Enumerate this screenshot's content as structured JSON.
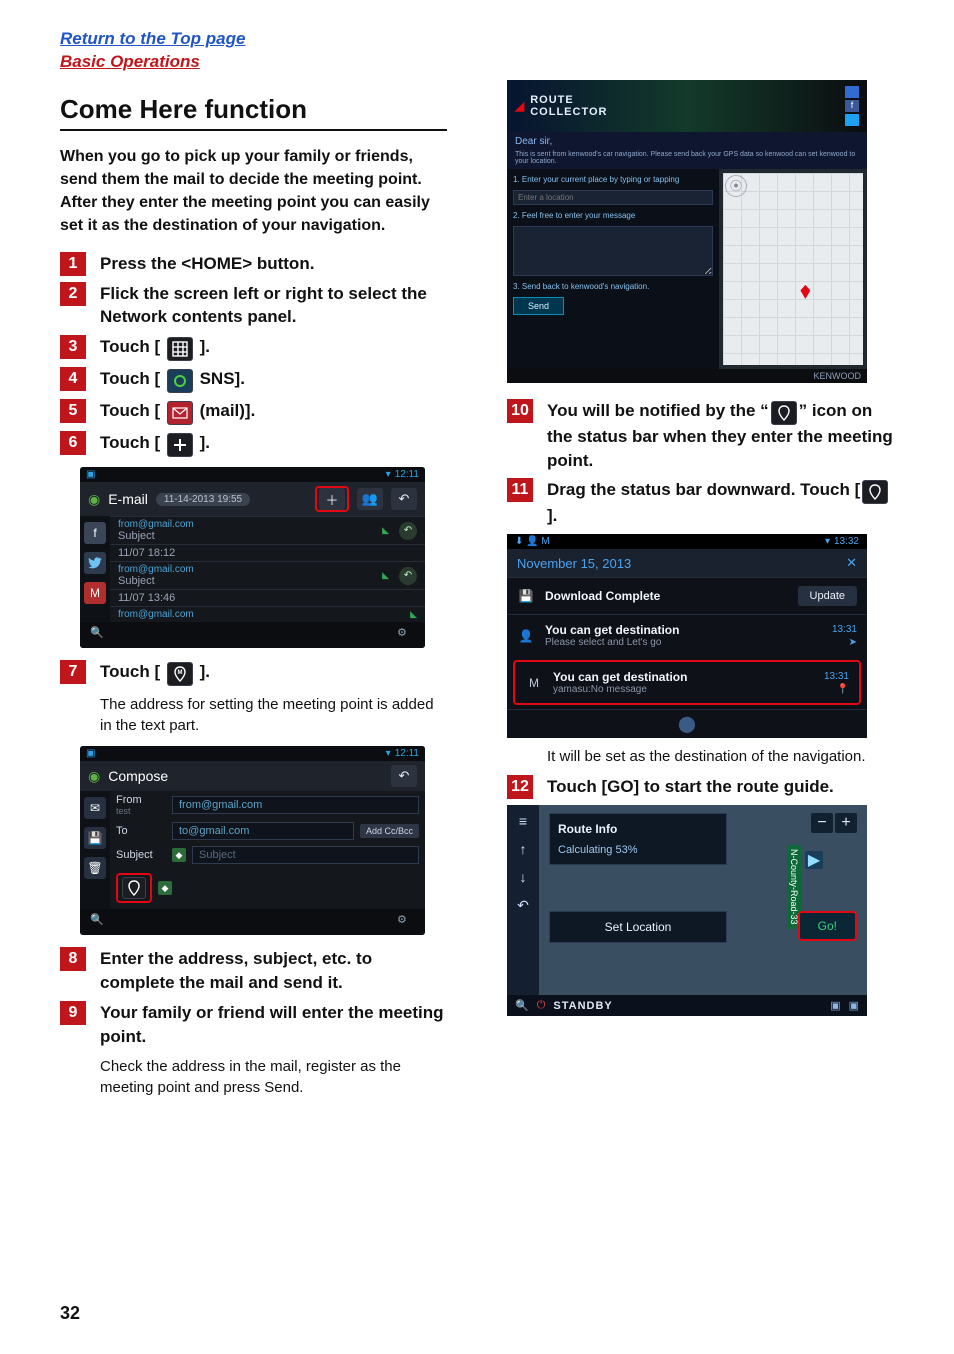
{
  "top_links": {
    "return": "Return to the Top page",
    "basic": "Basic Operations"
  },
  "title": "Come Here function",
  "intro": "When you go to pick up your family or friends, send them the mail to decide the meeting point. After they enter the meeting point you can easily set it as the destination of your navigation.",
  "steps": {
    "s1": "Press the <HOME> button.",
    "s2": "Flick the screen left or right to select the Network contents panel.",
    "s3a": "Touch [",
    "s3b": "].",
    "s4a": "Touch [",
    "s4b": "SNS].",
    "s5a": "Touch [",
    "s5b": "(mail)].",
    "s6a": "Touch [",
    "s6b": "].",
    "s7a": "Touch [",
    "s7b": "].",
    "s7_note": "The address for setting the meeting point is added in the text part.",
    "s8": "Enter the address, subject, etc. to complete the mail and send it.",
    "s9": "Your family or friend will enter the meeting point.",
    "s9_note": "Check the address in the mail, register as the meeting point and press Send.",
    "s10a": "You will be notified by the “",
    "s10b": "” icon on the status bar when they enter the meeting point.",
    "s11a": "Drag the status bar downward. Touch [",
    "s11b": "].",
    "s11_note": "It will be set as the destination of the navigation.",
    "s12": "Touch [GO] to start the route guide."
  },
  "email_shot": {
    "time": "12:11",
    "title": "E-mail",
    "date_chip": "11-14-2013 19:55",
    "rows": [
      {
        "from": "from@gmail.com",
        "subject": "Subject",
        "ts": ""
      },
      {
        "from": "",
        "subject": "",
        "ts": "11/07 18:12"
      },
      {
        "from": "from@gmail.com",
        "subject": "Subject",
        "ts": ""
      },
      {
        "from": "",
        "subject": "",
        "ts": "11/07 13:46"
      },
      {
        "from": "from@gmail.com",
        "subject": "",
        "ts": ""
      }
    ]
  },
  "compose_shot": {
    "time": "12:11",
    "title": "Compose",
    "from_label": "From",
    "from_sub": "test",
    "from_value": "from@gmail.com",
    "to_label": "To",
    "to_value": "to@gmail.com",
    "addccbcc": "Add Cc/Bcc",
    "subject_label": "Subject",
    "subject_placeholder": "Subject"
  },
  "rc_shot": {
    "brand1": "ROUTE",
    "brand2": "COLLECTOR",
    "dear": "Dear sir,",
    "sentence": "This is sent from kenwood's car navigation. Please send back your GPS data so kenwood can set kenwood to your location.",
    "step1": "1. Enter your current place by typing or tapping",
    "step1_ph": "Enter a location",
    "step2": "2. Feel free to enter your message",
    "step3": "3. Send back to kenwood's navigation.",
    "send": "Send",
    "footer": "KENWOOD"
  },
  "notif_shot": {
    "time": "13:32",
    "date": "November 15, 2013",
    "row1_primary": "Download Complete",
    "row1_btn": "Update",
    "row2_primary": "You can get destination",
    "row2_secondary": "Please select and Let's go",
    "row2_time": "13:31",
    "row3_primary": "You can get destination",
    "row3_secondary": "yamasu:No message",
    "row3_time": "13:31"
  },
  "nav_shot": {
    "route_info": "Route Info",
    "calc": "Calculating 53%",
    "setloc": "Set Location",
    "go": "Go!",
    "road": "N-County-Road-33",
    "standby": "STANDBY"
  },
  "page_number": "32"
}
